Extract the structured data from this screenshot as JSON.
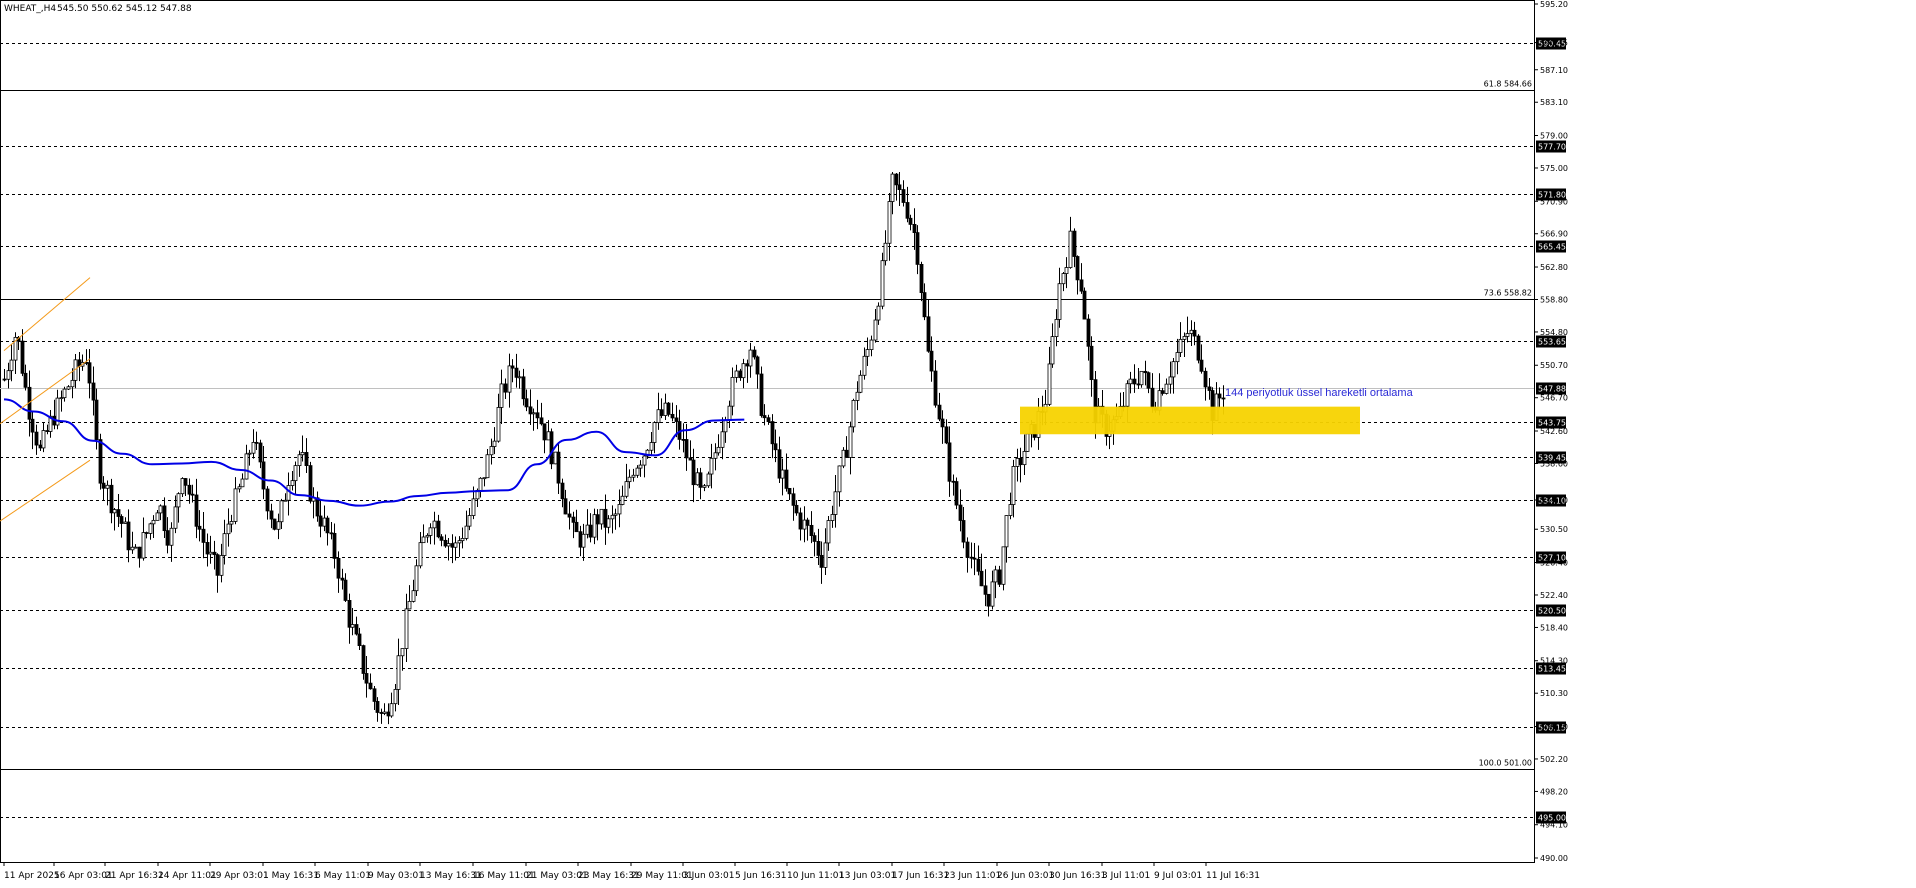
{
  "header": {
    "symbol": "WHEAT_,H4",
    "ohlc": "545.50 550.62 545.12 547.88"
  },
  "annotation": "144 periyotluk üssel hareketli ortalama",
  "chart_data": {
    "type": "candlestick",
    "title": "WHEAT_,H4",
    "ylim": [
      490,
      595.2
    ],
    "y_ticks": [
      "595.20",
      "590.45",
      "587.10",
      "583.10",
      "579.00",
      "575.00",
      "570.90",
      "566.90",
      "562.80",
      "558.80",
      "554.80",
      "550.70",
      "546.70",
      "542.60",
      "538.60",
      "534.10",
      "530.50",
      "526.40",
      "522.40",
      "518.40",
      "514.30",
      "510.30",
      "506.20",
      "502.20",
      "498.20",
      "494.10",
      "490.00"
    ],
    "x_ticks": [
      "11 Apr 2025",
      "16 Apr 03:01",
      "21 Apr 16:31",
      "24 Apr 11:01",
      "29 Apr 03:01",
      "1 May 16:31",
      "6 May 11:01",
      "9 May 03:01",
      "13 May 16:31",
      "16 May 11:01",
      "21 May 03:01",
      "23 May 16:31",
      "29 May 11:01",
      "3 Jun 03:01",
      "5 Jun 16:31",
      "10 Jun 11:01",
      "13 Jun 03:01",
      "17 Jun 16:31",
      "23 Jun 11:01",
      "26 Jun 03:01",
      "30 Jun 16:31",
      "3 Jul 11:01",
      "9 Jul 03:01",
      "11 Jul 16:31"
    ],
    "dashed_levels": [
      {
        "value": 590.45,
        "label": "590.45"
      },
      {
        "value": 577.7,
        "label": "577.70"
      },
      {
        "value": 571.8,
        "label": "571.80"
      },
      {
        "value": 565.45,
        "label": "565.45"
      },
      {
        "value": 553.65,
        "label": "553.65"
      },
      {
        "value": 543.75,
        "label": "543.75"
      },
      {
        "value": 539.45,
        "label": "539.45"
      },
      {
        "value": 534.1,
        "label": "534.10"
      },
      {
        "value": 527.1,
        "label": "527.10"
      },
      {
        "value": 520.5,
        "label": "520.50"
      },
      {
        "value": 513.45,
        "label": "513.45"
      },
      {
        "value": 506.15,
        "label": "506.15"
      },
      {
        "value": 495.0,
        "label": "495.00"
      }
    ],
    "fib_levels": [
      {
        "value": 584.66,
        "label": "61.8 584.66"
      },
      {
        "value": 558.82,
        "label": "73.6 558.82"
      },
      {
        "value": 501.0,
        "label": "100.0 501.00"
      }
    ],
    "current_price": {
      "value": 547.88,
      "label": "547.88"
    },
    "ema_144": [
      [
        0,
        546.5
      ],
      [
        0.05,
        545.0
      ],
      [
        0.1,
        543.8
      ],
      [
        0.15,
        541.4
      ],
      [
        0.2,
        539.8
      ],
      [
        0.25,
        538.5
      ],
      [
        0.3,
        538.6
      ],
      [
        0.35,
        538.8
      ],
      [
        0.4,
        537.8
      ],
      [
        0.45,
        536.5
      ],
      [
        0.5,
        534.7
      ],
      [
        0.55,
        534.0
      ],
      [
        0.6,
        533.4
      ],
      [
        0.65,
        533.9
      ],
      [
        0.7,
        534.6
      ],
      [
        0.75,
        535.0
      ],
      [
        0.8,
        535.2
      ],
      [
        0.85,
        535.3
      ],
      [
        0.9,
        538.5
      ],
      [
        0.95,
        541.5
      ],
      [
        1.0,
        542.5
      ],
      [
        1.05,
        540.0
      ],
      [
        1.1,
        539.6
      ],
      [
        1.15,
        542.7
      ],
      [
        1.2,
        543.9
      ],
      [
        1.25,
        544.0
      ]
    ],
    "close_path": [
      [
        0,
        549
      ],
      [
        0.02,
        555
      ],
      [
        0.04,
        546
      ],
      [
        0.06,
        540
      ],
      [
        0.08,
        544
      ],
      [
        0.1,
        547
      ],
      [
        0.12,
        550
      ],
      [
        0.14,
        552
      ],
      [
        0.16,
        538
      ],
      [
        0.18,
        534
      ],
      [
        0.2,
        531
      ],
      [
        0.22,
        527
      ],
      [
        0.24,
        530
      ],
      [
        0.26,
        534
      ],
      [
        0.28,
        529
      ],
      [
        0.3,
        538
      ],
      [
        0.32,
        533
      ],
      [
        0.34,
        528
      ],
      [
        0.36,
        525
      ],
      [
        0.38,
        532
      ],
      [
        0.4,
        536
      ],
      [
        0.42,
        542
      ],
      [
        0.44,
        535
      ],
      [
        0.46,
        530
      ],
      [
        0.48,
        537
      ],
      [
        0.5,
        540
      ],
      [
        0.52,
        534
      ],
      [
        0.54,
        531
      ],
      [
        0.56,
        527
      ],
      [
        0.58,
        520
      ],
      [
        0.6,
        515
      ],
      [
        0.62,
        510
      ],
      [
        0.64,
        507
      ],
      [
        0.66,
        512
      ],
      [
        0.68,
        520
      ],
      [
        0.7,
        527
      ],
      [
        0.72,
        532
      ],
      [
        0.74,
        530
      ],
      [
        0.76,
        528
      ],
      [
        0.78,
        531
      ],
      [
        0.8,
        535
      ],
      [
        0.82,
        540
      ],
      [
        0.84,
        547
      ],
      [
        0.86,
        551
      ],
      [
        0.88,
        547
      ],
      [
        0.9,
        545
      ],
      [
        0.92,
        541
      ],
      [
        0.94,
        536
      ],
      [
        0.96,
        530
      ],
      [
        0.98,
        529
      ],
      [
        1.0,
        532
      ],
      [
        1.02,
        531
      ],
      [
        1.04,
        533
      ],
      [
        1.06,
        538
      ],
      [
        1.08,
        540
      ],
      [
        1.1,
        544
      ],
      [
        1.12,
        545
      ],
      [
        1.14,
        542
      ],
      [
        1.16,
        538
      ],
      [
        1.18,
        534
      ],
      [
        1.2,
        540
      ],
      [
        1.22,
        546
      ],
      [
        1.24,
        550
      ],
      [
        1.26,
        553
      ],
      [
        1.28,
        545
      ],
      [
        1.3,
        540
      ],
      [
        1.32,
        535
      ],
      [
        1.34,
        532
      ],
      [
        1.36,
        530
      ],
      [
        1.38,
        527
      ],
      [
        1.4,
        534
      ],
      [
        1.42,
        540
      ],
      [
        1.44,
        548
      ],
      [
        1.46,
        553
      ],
      [
        1.48,
        561
      ],
      [
        1.5,
        573
      ],
      [
        1.52,
        571
      ],
      [
        1.54,
        566
      ],
      [
        1.56,
        552
      ],
      [
        1.58,
        544
      ],
      [
        1.6,
        536
      ],
      [
        1.62,
        530
      ],
      [
        1.64,
        525
      ],
      [
        1.66,
        522
      ],
      [
        1.68,
        525
      ],
      [
        1.7,
        536
      ],
      [
        1.72,
        540
      ],
      [
        1.74,
        543
      ],
      [
        1.76,
        547
      ],
      [
        1.78,
        560
      ],
      [
        1.8,
        566
      ],
      [
        1.82,
        560
      ],
      [
        1.84,
        545
      ],
      [
        1.86,
        543
      ],
      [
        1.88,
        544
      ],
      [
        1.9,
        548
      ],
      [
        1.92,
        550
      ],
      [
        1.94,
        546
      ],
      [
        1.96,
        549
      ],
      [
        1.98,
        552
      ],
      [
        2.0,
        555
      ],
      [
        2.02,
        552
      ],
      [
        2.04,
        545
      ],
      [
        2.06,
        547.88
      ]
    ]
  }
}
